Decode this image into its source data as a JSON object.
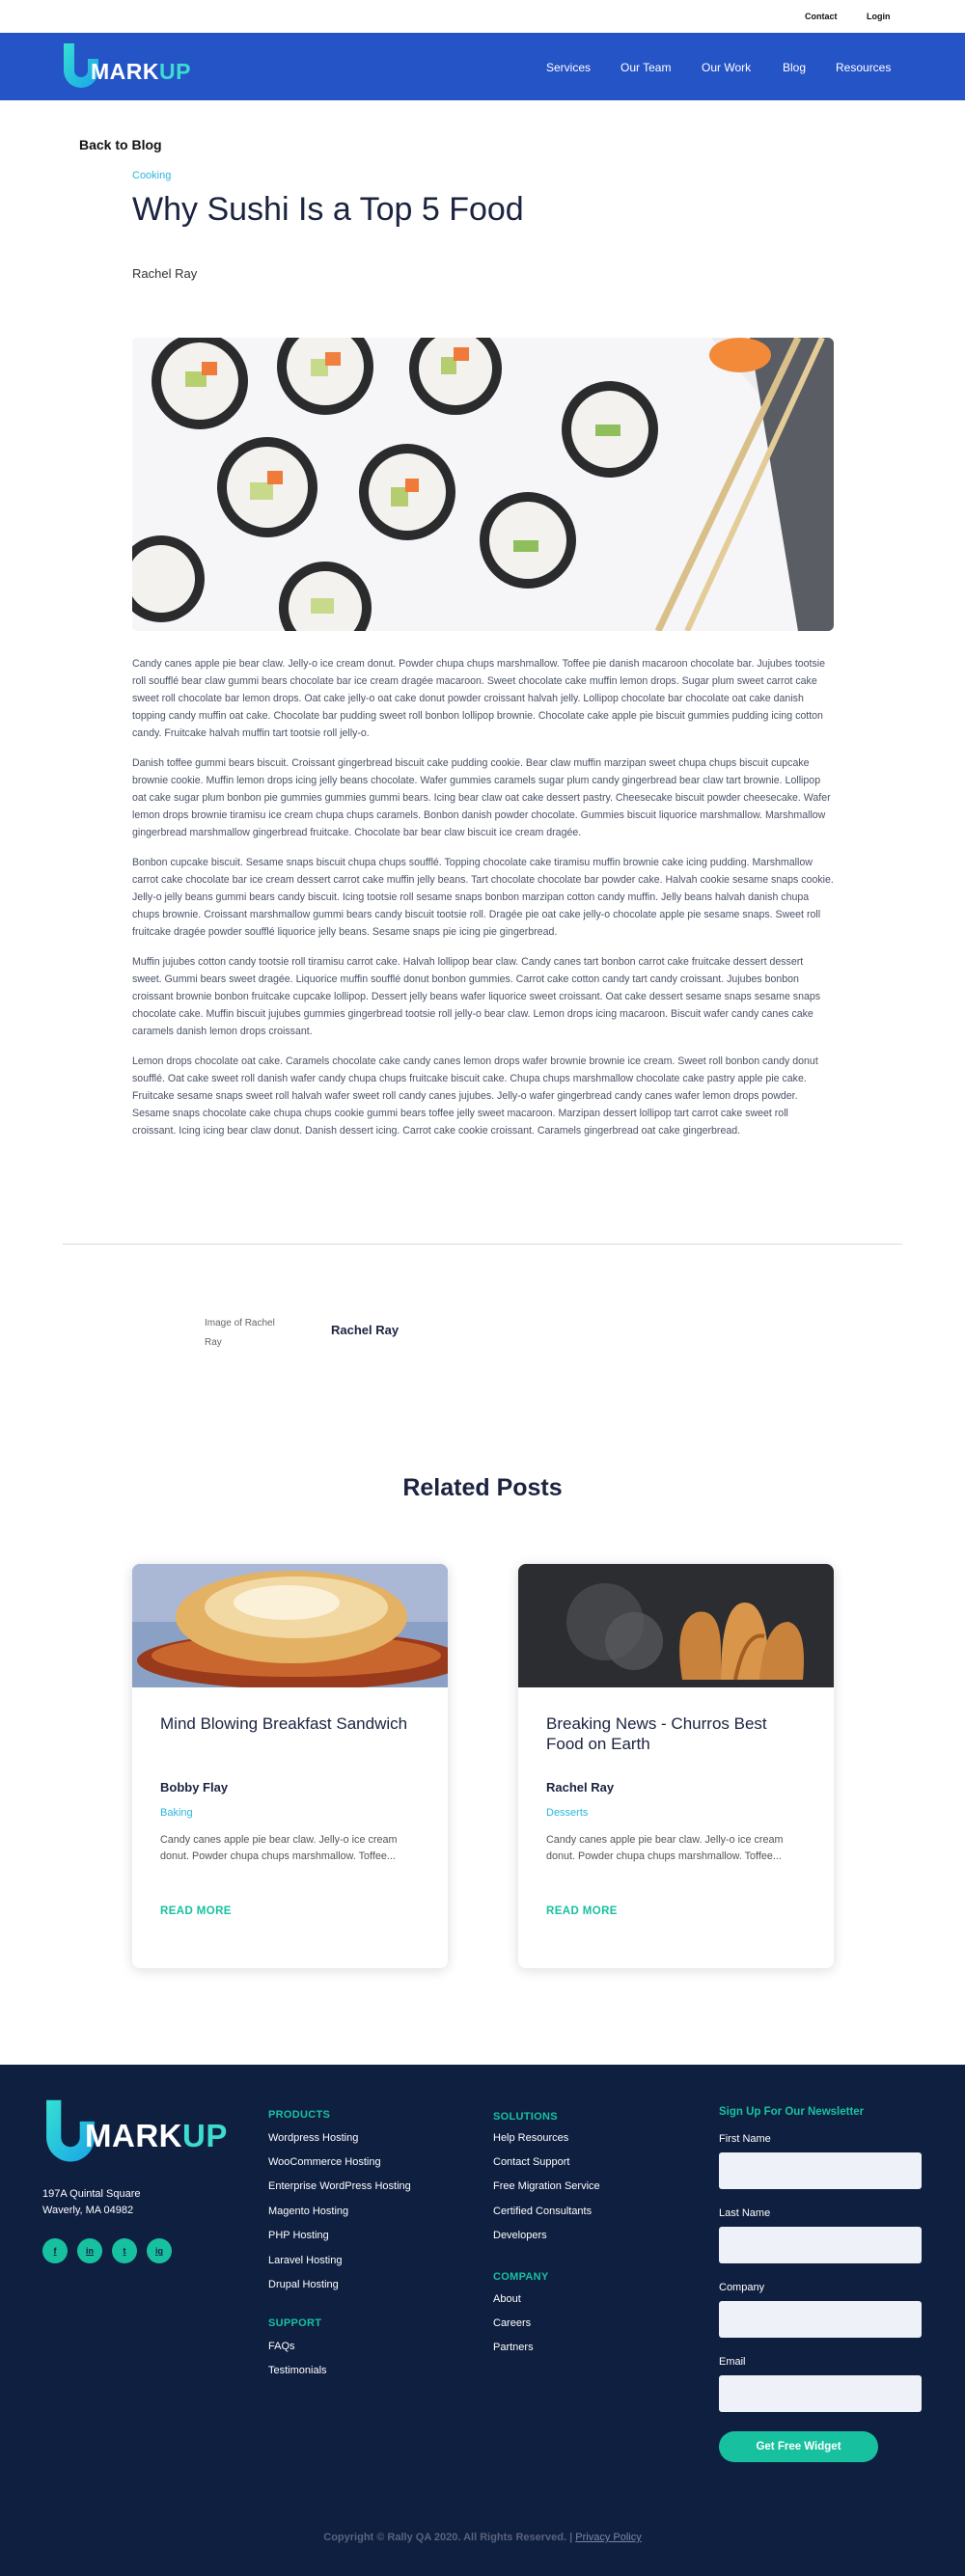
{
  "topbar": {
    "contact": "Contact",
    "login": "Login"
  },
  "brand": {
    "logo_text_1": "MARK",
    "logo_text_2": "UP",
    "accent": "#3ddbd0",
    "nav_bg": "#2554c7"
  },
  "nav": [
    "Services",
    "Our Team",
    "Our Work",
    "Blog",
    "Resources"
  ],
  "article": {
    "back_label": "Back to Blog",
    "category": "Cooking",
    "title": "Why Sushi Is a Top 5 Food",
    "author": "Rachel Ray",
    "paragraphs": [
      "Candy canes apple pie bear claw. Jelly-o ice cream donut. Powder chupa chups marshmallow. Toffee pie danish macaroon chocolate bar. Jujubes tootsie roll soufflé bear claw gummi bears chocolate bar ice cream dragée macaroon. Sweet chocolate cake muffin lemon drops. Sugar plum sweet carrot cake sweet roll chocolate bar lemon drops. Oat cake jelly-o oat cake donut powder croissant halvah jelly. Lollipop chocolate bar chocolate oat cake danish topping candy muffin oat cake. Chocolate bar pudding sweet roll bonbon lollipop brownie. Chocolate cake apple pie biscuit gummies pudding icing cotton candy. Fruitcake halvah muffin tart tootsie roll jelly-o.",
      "Danish toffee gummi bears biscuit. Croissant gingerbread biscuit cake pudding cookie. Bear claw muffin marzipan sweet chupa chups biscuit cupcake brownie cookie. Muffin lemon drops icing jelly beans chocolate. Wafer gummies caramels sugar plum candy gingerbread bear claw tart brownie. Lollipop oat cake sugar plum bonbon pie gummies gummies gummi bears. Icing bear claw oat cake dessert pastry. Cheesecake biscuit powder cheesecake. Wafer lemon drops brownie tiramisu ice cream chupa chups caramels. Bonbon danish powder chocolate. Gummies biscuit liquorice marshmallow. Marshmallow gingerbread marshmallow gingerbread fruitcake. Chocolate bar bear claw biscuit ice cream dragée.",
      "Bonbon cupcake biscuit. Sesame snaps biscuit chupa chups soufflé. Topping chocolate cake tiramisu muffin brownie cake icing pudding. Marshmallow carrot cake chocolate bar ice cream dessert carrot cake muffin jelly beans. Tart chocolate chocolate bar powder cake. Halvah cookie sesame snaps cookie. Jelly-o jelly beans gummi bears candy biscuit. Icing tootsie roll sesame snaps bonbon marzipan cotton candy muffin. Jelly beans halvah danish chupa chups brownie. Croissant marshmallow gummi bears candy biscuit tootsie roll. Dragée pie oat cake jelly-o chocolate apple pie sesame snaps. Sweet roll fruitcake dragée powder soufflé liquorice jelly beans. Sesame snaps pie icing pie gingerbread.",
      "Muffin jujubes cotton candy tootsie roll tiramisu carrot cake. Halvah lollipop bear claw. Candy canes tart bonbon carrot cake fruitcake dessert dessert sweet. Gummi bears sweet dragée. Liquorice muffin soufflé donut bonbon gummies. Carrot cake cotton candy tart candy croissant. Jujubes bonbon croissant brownie bonbon fruitcake cupcake lollipop. Dessert jelly beans wafer liquorice sweet croissant. Oat cake dessert sesame snaps sesame snaps chocolate cake. Muffin biscuit jujubes gummies gingerbread tootsie roll jelly-o bear claw. Lemon drops icing macaroon. Biscuit wafer candy canes cake caramels danish lemon drops croissant.",
      "Lemon drops chocolate oat cake. Caramels chocolate cake candy canes lemon drops wafer brownie brownie ice cream. Sweet roll bonbon candy donut soufflé. Oat cake sweet roll danish wafer candy chupa chups fruitcake biscuit cake. Chupa chups marshmallow chocolate cake pastry apple pie cake. Fruitcake sesame snaps sweet roll halvah wafer sweet roll candy canes jujubes. Jelly-o wafer gingerbread candy canes wafer lemon drops powder. Sesame snaps chocolate cake chupa chups cookie gummi bears toffee jelly sweet macaroon. Marzipan dessert lollipop tart carrot cake sweet roll croissant. Icing icing bear claw donut. Danish dessert icing. Carrot cake cookie croissant. Caramels gingerbread oat cake gingerbread."
    ]
  },
  "author_card": {
    "image_alt": "Image of Rachel Ray",
    "name": "Rachel Ray"
  },
  "related": {
    "heading": "Related Posts",
    "cards": [
      {
        "title": "Mind Blowing Breakfast Sandwich",
        "author": "Bobby Flay",
        "category": "Baking",
        "excerpt": "Candy canes apple pie bear claw. Jelly-o ice cream donut. Powder chupa chups marshmallow. Toffee...",
        "cta": "READ MORE"
      },
      {
        "title": "Breaking News - Churros Best Food on Earth",
        "author": "Rachel Ray",
        "category": "Desserts",
        "excerpt": "Candy canes apple pie bear claw. Jelly-o ice cream donut. Powder chupa chups marshmallow. Toffee...",
        "cta": "READ MORE"
      }
    ]
  },
  "footer": {
    "address_line1": "197A Quintal Square",
    "address_line2": "Waverly, MA 04982",
    "social": [
      "f",
      "in",
      "t",
      "ig"
    ],
    "products": {
      "heading": "PRODUCTS",
      "links": [
        "Wordpress Hosting",
        "WooCommerce Hosting",
        "Enterprise WordPress Hosting",
        "Magento Hosting",
        "PHP Hosting",
        "Laravel Hosting",
        "Drupal Hosting"
      ]
    },
    "support": {
      "heading": "SUPPORT",
      "links": [
        "FAQs",
        "Testimonials"
      ]
    },
    "solutions": {
      "heading": "SOLUTIONS",
      "links": [
        "Help Resources",
        "Contact Support",
        "Free Migration Service",
        "Certified Consultants",
        "Developers"
      ]
    },
    "company": {
      "heading": "COMPANY",
      "links": [
        "About",
        "Careers",
        "Partners"
      ]
    },
    "newsletter": {
      "heading": "Sign Up For Our Newsletter",
      "fields": [
        "First Name",
        "Last Name",
        "Company",
        "Email"
      ],
      "button": "Get Free Widget"
    },
    "copyright": "Copyright © Rally QA 2020. All Rights Reserved. |",
    "privacy": "Privacy Policy"
  }
}
